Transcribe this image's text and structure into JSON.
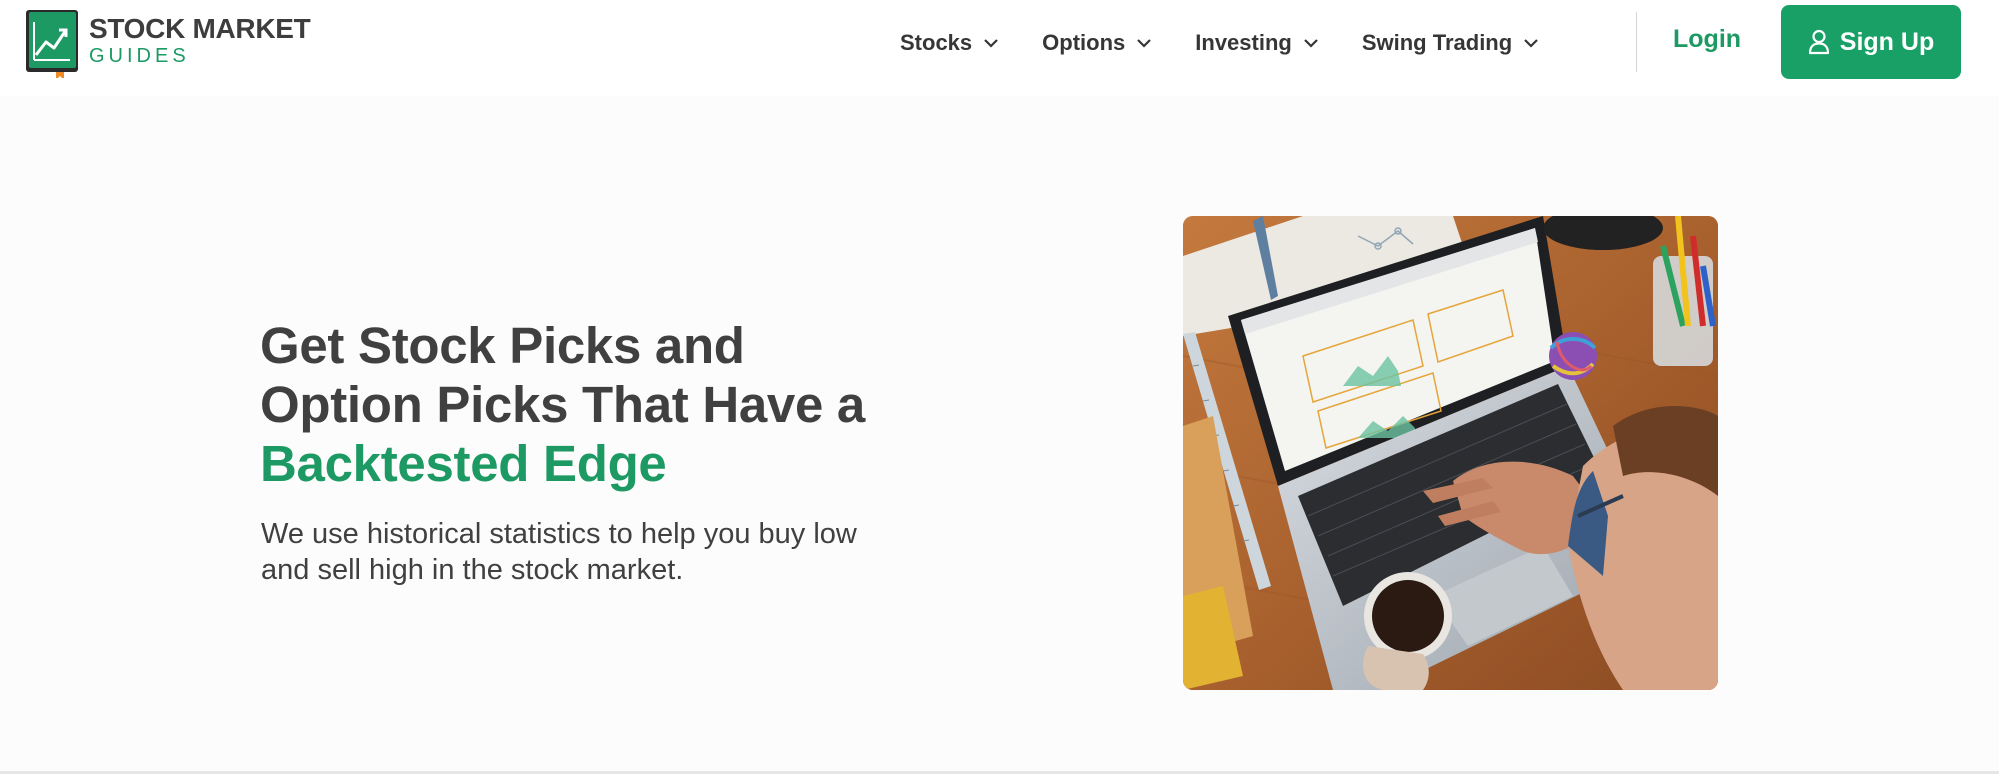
{
  "header": {
    "logo": {
      "line1": "STOCK MARKET",
      "line2": "GUIDES",
      "icon": "chart-book-icon"
    },
    "nav": [
      {
        "label": "Stocks",
        "icon": "chevron-down-icon"
      },
      {
        "label": "Options",
        "icon": "chevron-down-icon"
      },
      {
        "label": "Investing",
        "icon": "chevron-down-icon"
      },
      {
        "label": "Swing Trading",
        "icon": "chevron-down-icon"
      }
    ],
    "login_label": "Login",
    "signup_label": "Sign Up",
    "signup_icon": "user-icon"
  },
  "hero": {
    "title_line1": "Get Stock Picks and",
    "title_line2": "Option Picks That Have a",
    "title_accent": "Backtested Edge",
    "subtitle_line1": "We use historical statistics to help you buy low",
    "subtitle_line2": "and sell high in the stock market.",
    "image_icon": "laptop-photo"
  },
  "colors": {
    "brand_green": "#1d9a64",
    "button_green": "#19a067",
    "text_dark": "#404040",
    "background": "#fcfcfc"
  }
}
